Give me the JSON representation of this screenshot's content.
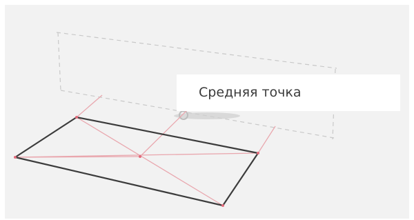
{
  "caption": {
    "text": "Средняя точка"
  },
  "colors": {
    "background": "#f2f2f2",
    "outline": "#3c3c3c",
    "construction": "#e8a0a8",
    "ghost": "#c4c4c4"
  }
}
